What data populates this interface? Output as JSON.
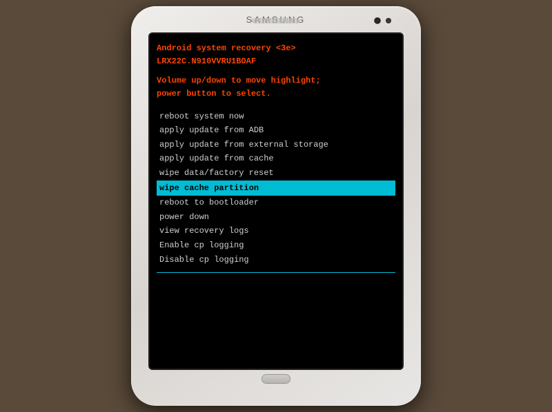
{
  "phone": {
    "brand": "SAMSUNG"
  },
  "screen": {
    "header1": "Android system recovery <3e>",
    "header2": "LRX22C.N910VVRU1BOAF",
    "instructions_line1": "Volume up/down to move highlight;",
    "instructions_line2": "power button to select.",
    "menu_items": [
      {
        "id": "reboot-system",
        "label": "reboot system now",
        "selected": false
      },
      {
        "id": "apply-update-adb",
        "label": "apply update from ADB",
        "selected": false
      },
      {
        "id": "apply-update-external",
        "label": "apply update from external storage",
        "selected": false
      },
      {
        "id": "apply-update-cache",
        "label": "apply update from cache",
        "selected": false
      },
      {
        "id": "wipe-data",
        "label": "wipe data/factory reset",
        "selected": false
      },
      {
        "id": "wipe-cache",
        "label": "wipe cache partition",
        "selected": true
      },
      {
        "id": "reboot-bootloader",
        "label": "reboot to bootloader",
        "selected": false
      },
      {
        "id": "power-down",
        "label": "power down",
        "selected": false
      },
      {
        "id": "view-recovery-logs",
        "label": "view recovery logs",
        "selected": false
      },
      {
        "id": "enable-cp-logging",
        "label": "Enable cp logging",
        "selected": false
      },
      {
        "id": "disable-cp-logging",
        "label": "Disable cp logging",
        "selected": false
      }
    ]
  },
  "colors": {
    "header_color": "#ff4400",
    "selected_bg": "#00bcd4",
    "selected_text": "#000000",
    "normal_text": "#d0d0d0",
    "screen_bg": "#000000"
  }
}
